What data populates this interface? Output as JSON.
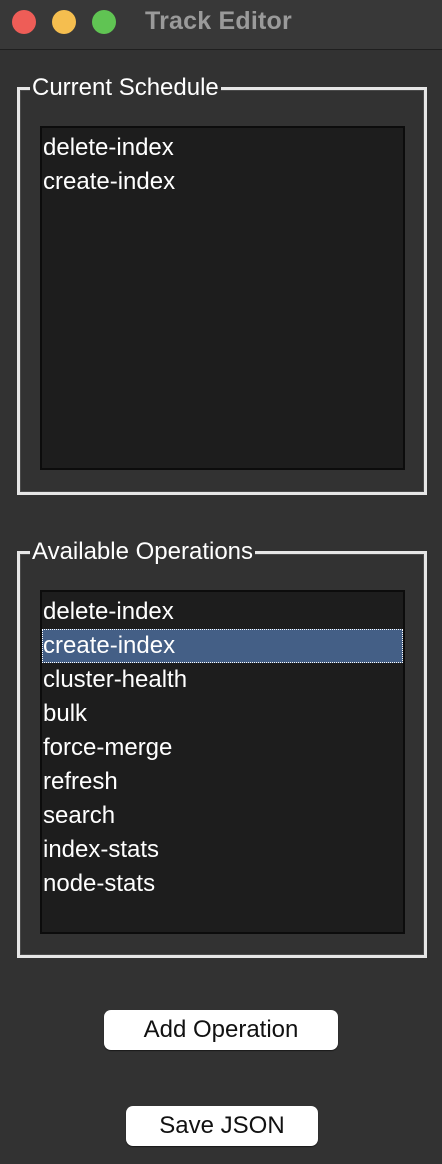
{
  "window": {
    "title": "Track Editor"
  },
  "current_schedule": {
    "label": "Current Schedule",
    "items": [
      "delete-index",
      "create-index"
    ]
  },
  "available_operations": {
    "label": "Available Operations",
    "items": [
      "delete-index",
      "create-index",
      "cluster-health",
      "bulk",
      "force-merge",
      "refresh",
      "search",
      "index-stats",
      "node-stats"
    ],
    "selected": "create-index"
  },
  "buttons": {
    "add_operation": "Add Operation",
    "save_json": "Save JSON"
  },
  "colors": {
    "background": "#323232",
    "list_background": "#1d1d1d",
    "selection": "#445f86",
    "close": "#ee5d57",
    "minimize": "#f5be4f",
    "zoom": "#60c453"
  },
  "icons": [
    "close-button",
    "minimize-button",
    "zoom-button"
  ]
}
